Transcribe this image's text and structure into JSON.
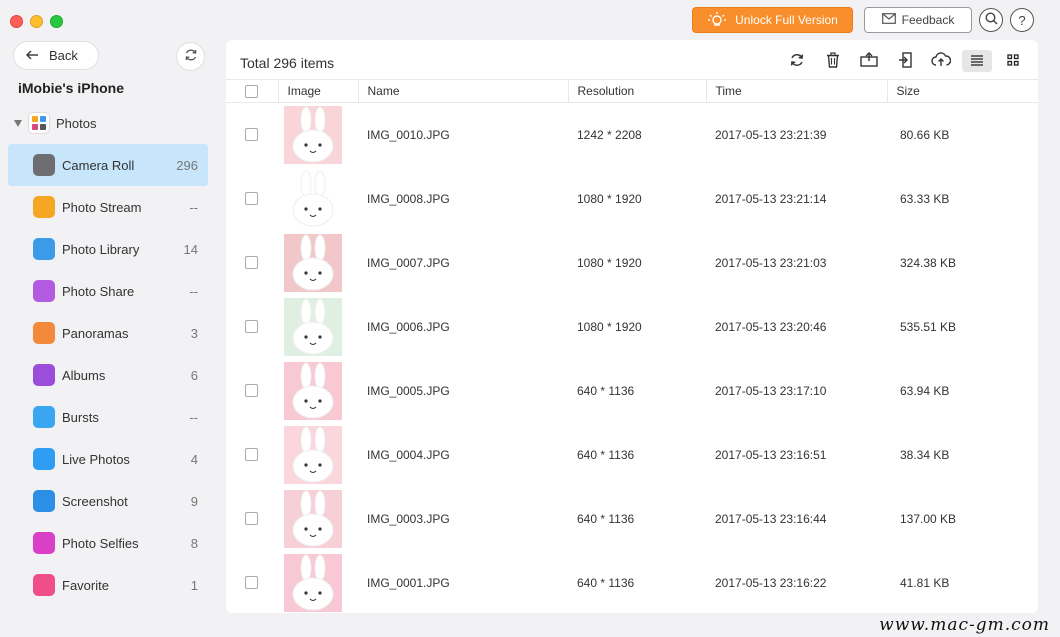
{
  "window": {
    "unlock_label": "Unlock Full Version",
    "feedback_label": "Feedback",
    "help_label": "?"
  },
  "sidebar": {
    "back_label": "Back",
    "device_name": "iMobie's iPhone",
    "section_label": "Photos",
    "items": [
      {
        "label": "Camera Roll",
        "count": "296",
        "icon": "camera-icon",
        "color": "#6d6d72",
        "active": true
      },
      {
        "label": "Photo Stream",
        "count": "--",
        "icon": "sunflower-icon",
        "color": "#f5a623"
      },
      {
        "label": "Photo Library",
        "count": "14",
        "icon": "folder-icon",
        "color": "#3b9be8"
      },
      {
        "label": "Photo Share",
        "count": "--",
        "icon": "share-icon",
        "color": "#b35be0"
      },
      {
        "label": "Panoramas",
        "count": "3",
        "icon": "panorama-icon",
        "color": "#f3893b"
      },
      {
        "label": "Albums",
        "count": "6",
        "icon": "album-icon",
        "color": "#9b4ddb"
      },
      {
        "label": "Bursts",
        "count": "--",
        "icon": "bursts-icon",
        "color": "#3aa5f0"
      },
      {
        "label": "Live Photos",
        "count": "4",
        "icon": "live-photo-icon",
        "color": "#2f9df4"
      },
      {
        "label": "Screenshot",
        "count": "9",
        "icon": "screenshot-icon",
        "color": "#2b8fe5"
      },
      {
        "label": "Photo Selfies",
        "count": "8",
        "icon": "selfie-icon",
        "color": "#d93fc7"
      },
      {
        "label": "Favorite",
        "count": "1",
        "icon": "heart-icon",
        "color": "#f04e87"
      }
    ]
  },
  "main": {
    "total_label": "Total 296 items",
    "columns": {
      "image": "Image",
      "name": "Name",
      "resolution": "Resolution",
      "time": "Time",
      "size": "Size"
    },
    "rows": [
      {
        "name": "IMG_0010.JPG",
        "resolution": "1242 * 2208",
        "time": "2017-05-13 23:21:39",
        "size": "80.66 KB",
        "bg": "#f9d4d9"
      },
      {
        "name": "IMG_0008.JPG",
        "resolution": "1080 * 1920",
        "time": "2017-05-13 23:21:14",
        "size": "63.33 KB",
        "bg": "#ffffff"
      },
      {
        "name": "IMG_0007.JPG",
        "resolution": "1080 * 1920",
        "time": "2017-05-13 23:21:03",
        "size": "324.38 KB",
        "bg": "#f2c7c9"
      },
      {
        "name": "IMG_0006.JPG",
        "resolution": "1080 * 1920",
        "time": "2017-05-13 23:20:46",
        "size": "535.51 KB",
        "bg": "#dff0e2"
      },
      {
        "name": "IMG_0005.JPG",
        "resolution": "640 * 1136",
        "time": "2017-05-13 23:17:10",
        "size": "63.94 KB",
        "bg": "#f8c9d3"
      },
      {
        "name": "IMG_0004.JPG",
        "resolution": "640 * 1136",
        "time": "2017-05-13 23:16:51",
        "size": "38.34 KB",
        "bg": "#fbd6dc"
      },
      {
        "name": "IMG_0003.JPG",
        "resolution": "640 * 1136",
        "time": "2017-05-13 23:16:44",
        "size": "137.00 KB",
        "bg": "#f7d0d7"
      },
      {
        "name": "IMG_0001.JPG",
        "resolution": "640 * 1136",
        "time": "2017-05-13 23:16:22",
        "size": "41.81 KB",
        "bg": "#f8c8d4"
      }
    ]
  },
  "watermark": "www.mac-gm.com"
}
